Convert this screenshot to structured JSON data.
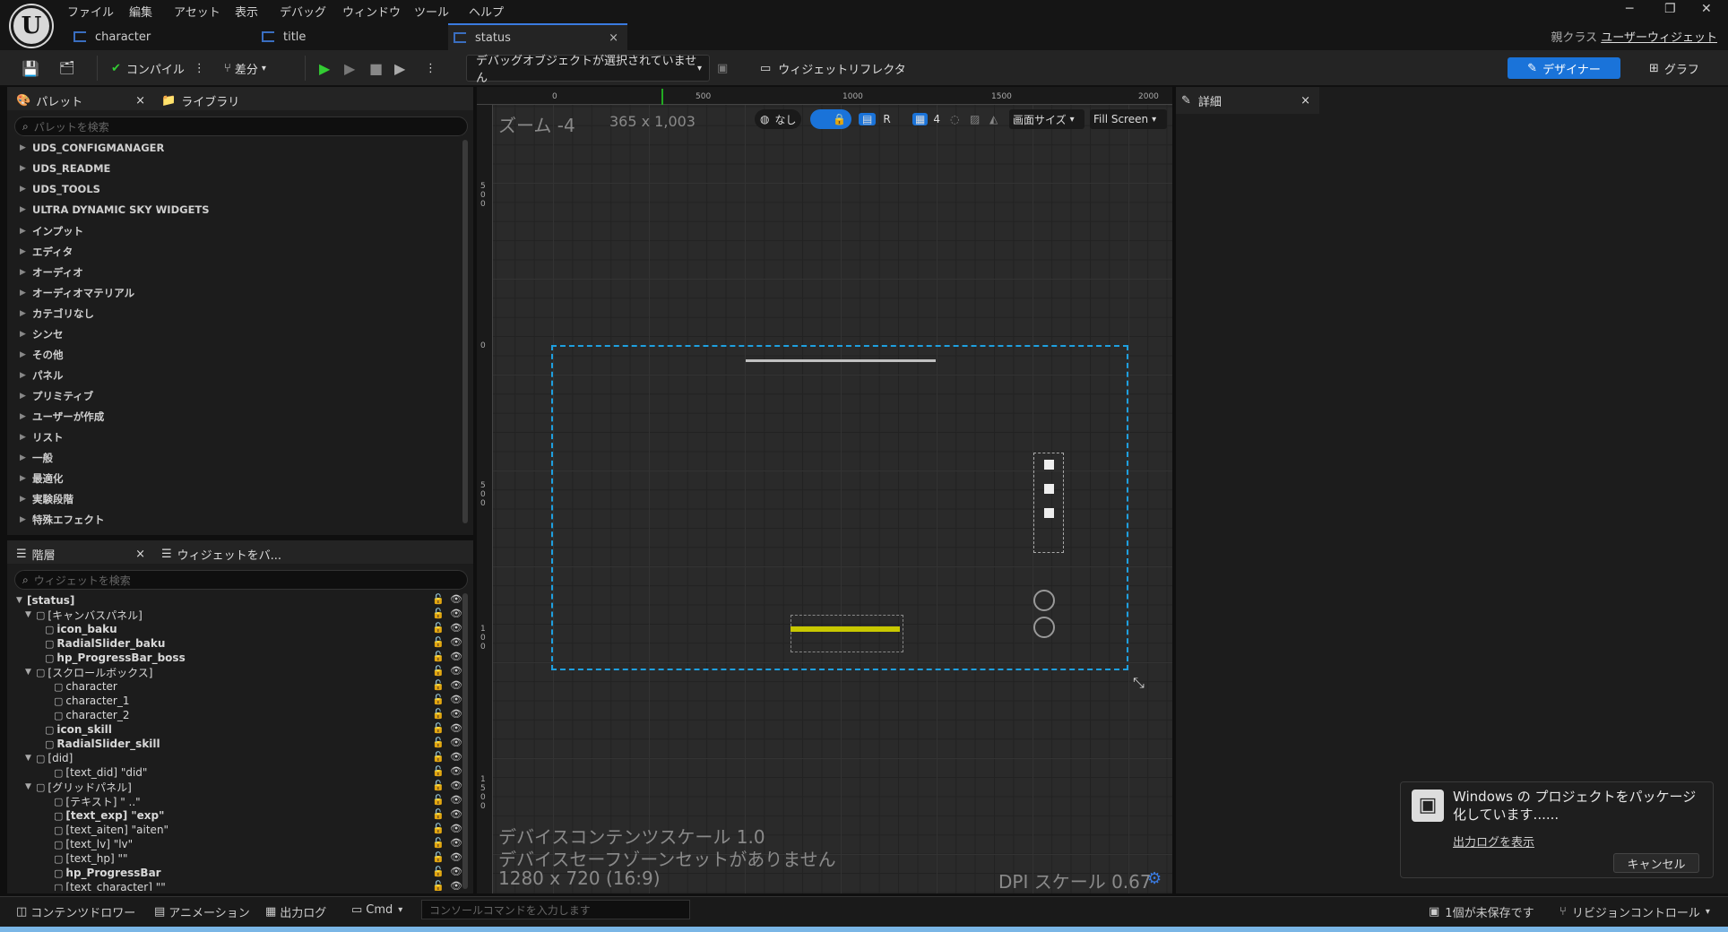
{
  "menu": [
    "ファイル",
    "編集",
    "アセット",
    "表示",
    "デバッグ",
    "ウィンドウ",
    "ツール",
    "ヘルプ"
  ],
  "tabs": [
    {
      "label": "character"
    },
    {
      "label": "title"
    },
    {
      "label": "status",
      "close": "×"
    }
  ],
  "parent_class": {
    "label": "親クラス",
    "value": "ユーザーウィジェット"
  },
  "toolbar": {
    "compile": "コンパイル",
    "diff": "差分",
    "debug_select": "デバッグオブジェクトが選択されていません",
    "widget_reflector": "ウィジェットリフレクタ",
    "designer": "デザイナー",
    "graph": "グラフ"
  },
  "palette": {
    "tab_palette": "パレット",
    "tab_library": "ライブラリ",
    "search_placeholder": "パレットを検索",
    "items": [
      "UDS_CONFIGMANAGER",
      "UDS_README",
      "UDS_TOOLS",
      "ULTRA DYNAMIC SKY WIDGETS",
      "インプット",
      "エディタ",
      "オーディオ",
      "オーディオマテリアル",
      "カテゴリなし",
      "シンセ",
      "その他",
      "パネル",
      "プリミティブ",
      "ユーザーが作成",
      "リスト",
      "一般",
      "最適化",
      "実験段階",
      "特殊エフェクト"
    ]
  },
  "hierarchy": {
    "tab_hierarchy": "階層",
    "tab_bind": "ウィジェットをバ...",
    "search_placeholder": "ウィジェットを検索",
    "rows": [
      {
        "label": "[status]",
        "indent": 0,
        "bold": true,
        "expand": "▼"
      },
      {
        "label": "[キャンバスパネル]",
        "indent": 1,
        "bold": false,
        "expand": "▼"
      },
      {
        "label": "icon_baku",
        "indent": 2,
        "bold": true,
        "expand": ""
      },
      {
        "label": "RadialSlider_baku",
        "indent": 2,
        "bold": true,
        "expand": ""
      },
      {
        "label": "hp_ProgressBar_boss",
        "indent": 2,
        "bold": true,
        "expand": ""
      },
      {
        "label": "[スクロールボックス]",
        "indent": 1,
        "bold": false,
        "expand": "▼"
      },
      {
        "label": "character",
        "indent": 3,
        "bold": false,
        "expand": ""
      },
      {
        "label": "character_1",
        "indent": 3,
        "bold": false,
        "expand": ""
      },
      {
        "label": "character_2",
        "indent": 3,
        "bold": false,
        "expand": ""
      },
      {
        "label": "icon_skill",
        "indent": 2,
        "bold": true,
        "expand": ""
      },
      {
        "label": "RadialSlider_skill",
        "indent": 2,
        "bold": true,
        "expand": ""
      },
      {
        "label": "[did]",
        "indent": 1,
        "bold": false,
        "expand": "▼"
      },
      {
        "label": "[text_did] \"did\"",
        "indent": 3,
        "bold": false,
        "expand": ""
      },
      {
        "label": "[グリッドパネル]",
        "indent": 1,
        "bold": false,
        "expand": "▼"
      },
      {
        "label": "[テキスト] \"         ..\"",
        "indent": 3,
        "bold": false,
        "expand": ""
      },
      {
        "label": "[text_exp] \"exp\"",
        "indent": 3,
        "bold": true,
        "expand": ""
      },
      {
        "label": "[text_aiten] \"aiten\"",
        "indent": 3,
        "bold": false,
        "expand": ""
      },
      {
        "label": "[text_lv] \"lv\"",
        "indent": 3,
        "bold": false,
        "expand": ""
      },
      {
        "label": "[text_hp] \"\"",
        "indent": 3,
        "bold": false,
        "expand": ""
      },
      {
        "label": "hp_ProgressBar",
        "indent": 3,
        "bold": true,
        "expand": ""
      },
      {
        "label": "[text_character] \"\"",
        "indent": 3,
        "bold": false,
        "expand": ""
      }
    ]
  },
  "viewport": {
    "zoom": "ズーム -4",
    "size": "365 x 1,003",
    "none_label": "なし",
    "r_label": "R",
    "grid_num": "4",
    "screen_size": "画面サイズ",
    "fill_screen": "Fill Screen",
    "ruler_top": [
      "0",
      "500",
      "1000",
      "1500",
      "2000"
    ],
    "ruler_left": [
      "5\n0\n0",
      "0",
      "5\n0\n0",
      "1\n0\n0",
      "1\n5\n0\n0"
    ],
    "content_scale": "デバイスコンテンツスケール 1.0",
    "safe_zone": "デバイスセーフゾーンセットがありません",
    "resolution": "1280 x 720 (16:9)",
    "dpi": "DPI スケール 0.67"
  },
  "details": {
    "tab": "詳細"
  },
  "statusbar": {
    "content_drawer": "コンテンツドロワー",
    "animation": "アニメーション",
    "output_log": "出力ログ",
    "cmd": "Cmd",
    "console_placeholder": "コンソールコマンドを入力します",
    "unsaved": "1個が未保存です",
    "revision": "リビジョンコントロール"
  },
  "notification": {
    "title": "Windows の プロジェクトをパッケージ化しています......",
    "link": "出力ログを表示",
    "cancel": "キャンセル"
  },
  "colors": {
    "accent": "#1a73d9",
    "canvas_border": "#1ea0e0",
    "progress": "#c8c800"
  }
}
